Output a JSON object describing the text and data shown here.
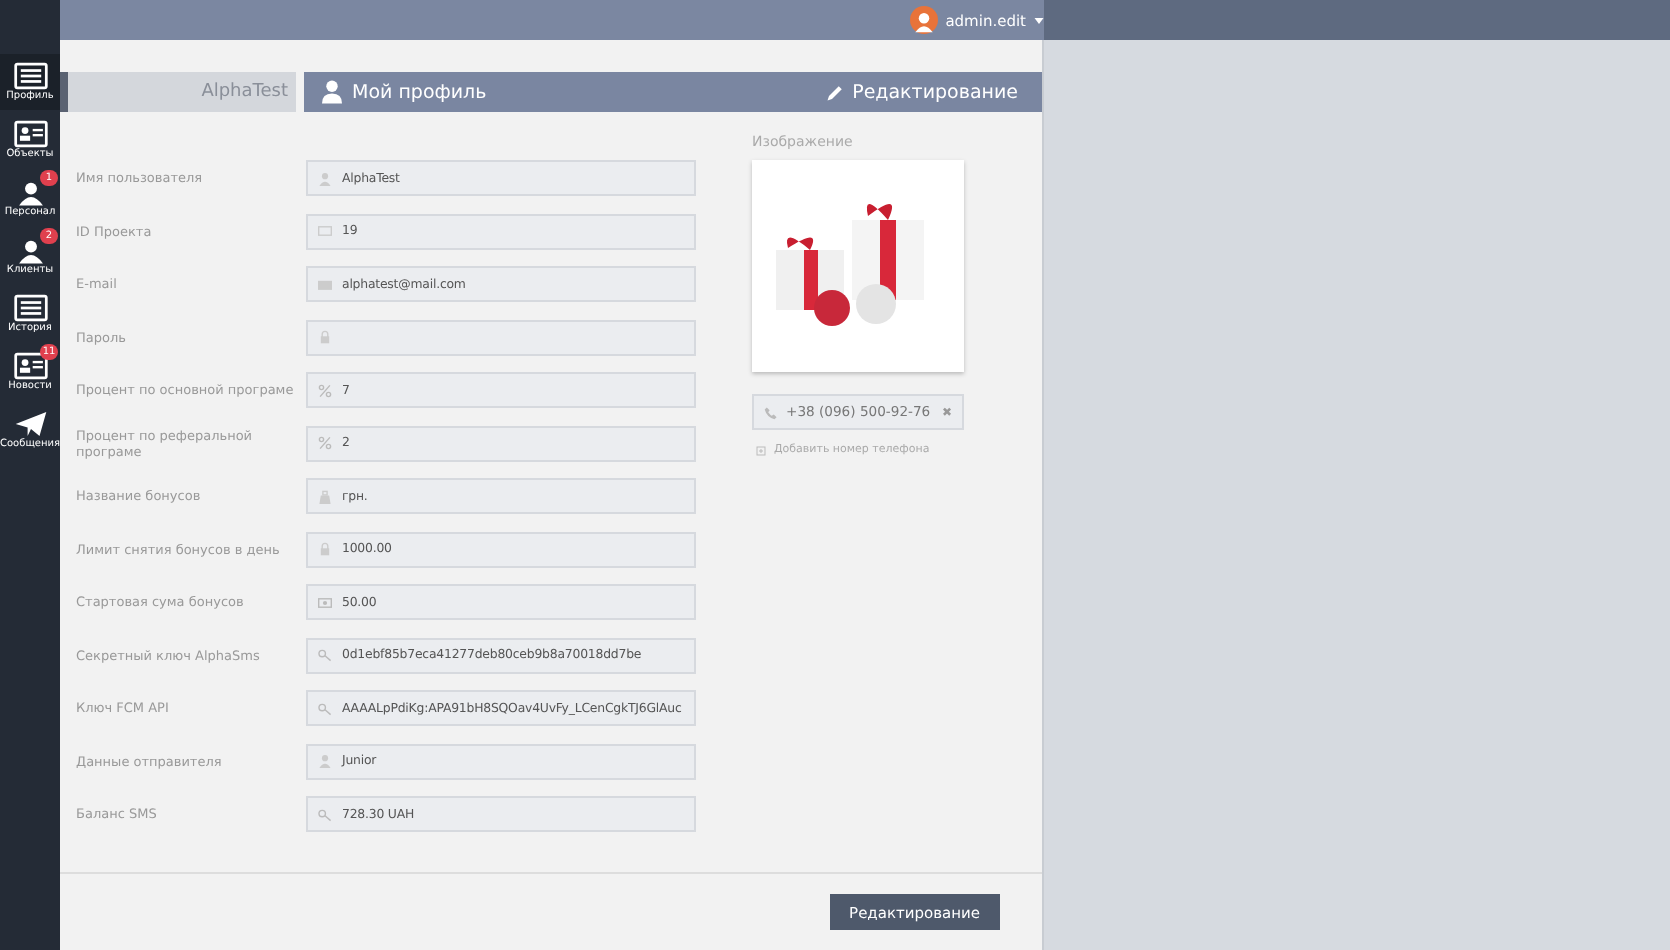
{
  "user_menu": {
    "name": "admin.edit"
  },
  "sidebar": {
    "items": [
      {
        "label": "Профиль",
        "selected": true
      },
      {
        "label": "Объекты",
        "selected": false
      },
      {
        "label": "Персонал",
        "selected": false,
        "badge": "1"
      },
      {
        "label": "Клиенты",
        "selected": false,
        "badge": "2"
      },
      {
        "label": "История",
        "selected": false
      },
      {
        "label": "Новости",
        "selected": false,
        "badge": "11"
      },
      {
        "label": "Сообщения",
        "selected": false
      }
    ]
  },
  "tabs": {
    "account": "AlphaTest",
    "title": "Мой профиль",
    "action": "Редактирование"
  },
  "form": {
    "fields": [
      {
        "label": "Имя пользователя",
        "value": "AlphaTest"
      },
      {
        "label": "ID Проекта",
        "value": "19"
      },
      {
        "label": "E-mail",
        "value": "alphatest@mail.com"
      },
      {
        "label": "Пароль"
      },
      {
        "label": "Процент по основной програме",
        "value": "7"
      },
      {
        "label": "Процент по реферальной програме",
        "value": "2"
      },
      {
        "label": "Название бонусов",
        "value": "грн."
      },
      {
        "label": "Лимит снятия бонусов в день",
        "value": "1000.00"
      },
      {
        "label": "Стартовая сума бонусов",
        "value": "50.00"
      },
      {
        "label": "Секретный ключ AlphaSms",
        "value": "0d1ebf85b7eca41277deb80ceb9b8a70018dd7be"
      },
      {
        "label": "Ключ FCM API",
        "value": "AAAALpPdiKg:APA91bH8SQOav4UvFy_LCenCgkTJ6GlAuc"
      },
      {
        "label": "Данные отправителя",
        "value": "Junior"
      },
      {
        "label": "Баланс SMS",
        "value": "728.30 UAH"
      }
    ]
  },
  "image": {
    "label": "Изображение",
    "kind": "picture"
  },
  "phones": [
    {
      "value": "+38 (096) 500-92-76",
      "remove": "✖"
    }
  ],
  "add_phone": "Добавить номер телефона",
  "footer": {
    "button": "Редактирование"
  }
}
